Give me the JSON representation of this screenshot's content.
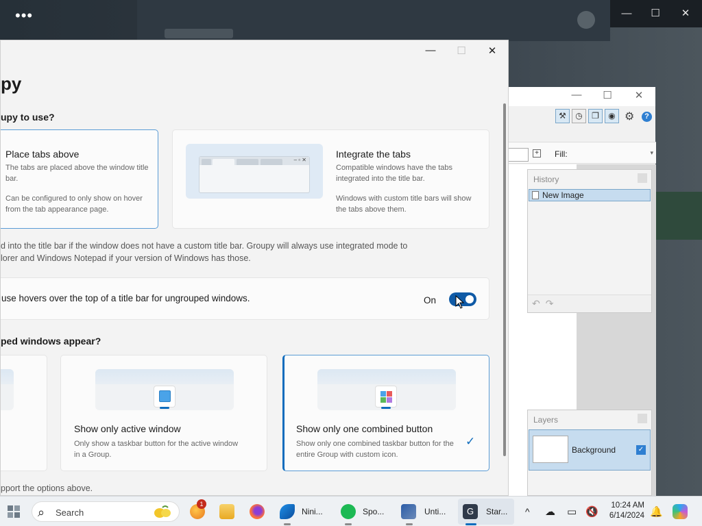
{
  "background_app": {
    "more": "•••",
    "controls": {
      "minimize": "—",
      "maximize": "☐",
      "close": "✕"
    }
  },
  "paint": {
    "controls": {
      "minimize": "—",
      "maximize": "☐",
      "close": "✕"
    },
    "fill_label": "Fill:",
    "history_title": "History",
    "history_item": "New Image",
    "layers_title": "Layers",
    "layer_name": "Background"
  },
  "groupy": {
    "controls": {
      "minimize": "—",
      "maximize": "☐",
      "close": "✕"
    },
    "title": "py",
    "q1": "upy to use?",
    "option_above": {
      "title": "Place tabs above",
      "desc1": "The tabs are placed above the window title bar.",
      "desc2": "Can be configured to only show on hover from the tab appearance page."
    },
    "option_integrate": {
      "title": "Integrate the tabs",
      "desc1": "Compatible windows have the tabs integrated into the title bar.",
      "desc2": "Windows with custom title bars will show the tabs above them."
    },
    "note_line1": "d into the title bar if the window does not have a custom title bar.  Groupy will always use integrated mode to",
    "note_line2": "lorer and Windows Notepad if your version of Windows has those.",
    "hover_setting": "use hovers over the top of a title bar for ungrouped windows.",
    "hover_state": "On",
    "q2": "ped windows appear?",
    "option_active": {
      "title": "Show only active window",
      "desc": "Only show a taskbar button for the active window in a Group."
    },
    "option_combined": {
      "title": "Show only one combined button",
      "desc": "Show only one combined taskbar button for the entire Group with custom icon."
    },
    "footer": "pport the options above."
  },
  "taskbar": {
    "search_placeholder": "Search",
    "badge": "1",
    "apps": [
      {
        "label": "Nini..."
      },
      {
        "label": "Spo..."
      },
      {
        "label": "Unti..."
      },
      {
        "label": "Star..."
      }
    ],
    "time": "10:24 AM",
    "date": "6/14/2024",
    "chevron": "^"
  }
}
